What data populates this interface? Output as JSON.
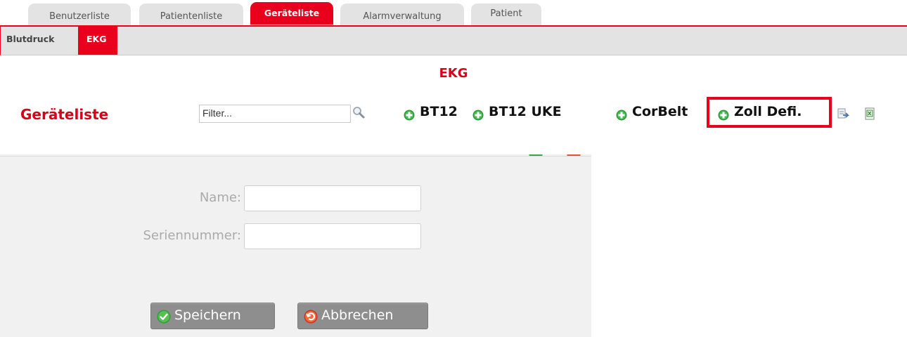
{
  "tabs": [
    {
      "label": "Benutzerliste",
      "active": false
    },
    {
      "label": "Patientenliste",
      "active": false
    },
    {
      "label": "Geräteliste",
      "active": true
    },
    {
      "label": "Alarmverwaltung",
      "active": false
    },
    {
      "label": "Patient",
      "active": false
    }
  ],
  "subtabs": [
    {
      "label": "Blutdruck",
      "active": false
    },
    {
      "label": "EKG",
      "active": true
    }
  ],
  "page": {
    "title": "EKG",
    "list_title": "Geräteliste"
  },
  "filter": {
    "value": "Filter..."
  },
  "devices": [
    {
      "label": "BT12"
    },
    {
      "label": "BT12 UKE"
    },
    {
      "label": "CorBelt"
    },
    {
      "label": "Zoll Defi.",
      "highlighted": true
    }
  ],
  "toolbar_icons": [
    "export-icon",
    "excel-icon"
  ],
  "form": {
    "name_label": "Name:",
    "name_value": "",
    "serial_label": "Seriennummer:",
    "serial_value": "",
    "save_label": "Speichern",
    "cancel_label": "Abbrechen"
  },
  "colors": {
    "accent": "#e8001c",
    "tab_bg": "#e3e3e3",
    "button_bg": "#8e8e8e",
    "panel_bg": "#f1f1f1"
  }
}
